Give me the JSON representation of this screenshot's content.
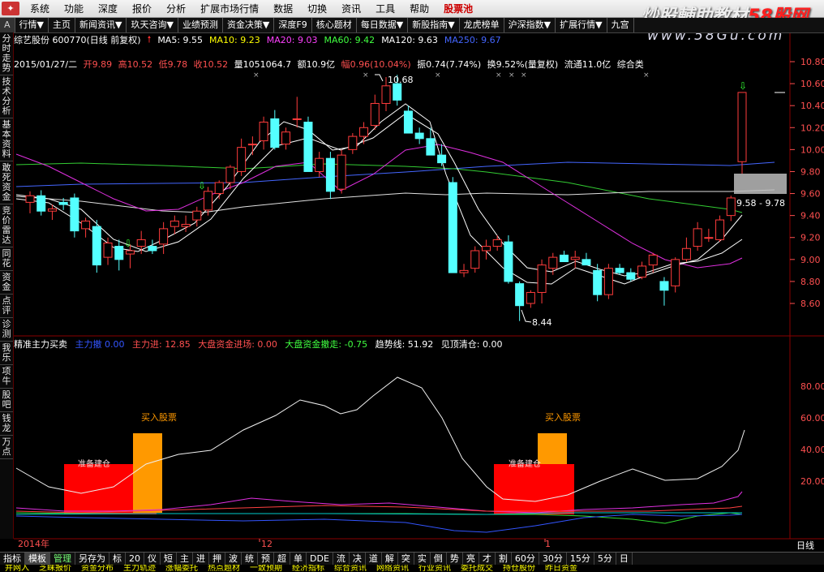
{
  "menubar": {
    "items": [
      "系统",
      "功能",
      "深度",
      "报价",
      "分析",
      "扩展市场行情",
      "数据",
      "切换",
      "资讯",
      "工具",
      "帮助",
      "股票池",
      "闪电"
    ],
    "pool_label": "股票池"
  },
  "watermark": {
    "part1": "炒股輔助教材",
    "part2": "58股网",
    "url": "www.58Gu.com"
  },
  "toolbar": {
    "items": [
      "A",
      "行情▼",
      "主页",
      "新闻资讯▼",
      "玖天咨询▼",
      "业绩预测",
      "资金决策▼",
      "深度F9",
      "核心题材",
      "每日数据▼",
      "新股指南▼",
      "龙虎榜单",
      "沪深指数▼",
      "扩展行情▼",
      "九宫"
    ]
  },
  "sidebar": {
    "items": [
      "分时走势",
      "技术分析",
      "基本资料",
      "敢死资金",
      "竞价雷达",
      "同花",
      "资金",
      "点评",
      "诊测",
      "我乐",
      "项牛",
      "股吧",
      "钱龙",
      "万点"
    ]
  },
  "header": {
    "stock": "综艺股份 600770(日线 前复权)",
    "ma5": "MA5: 9.55",
    "ma10": "MA10: 9.23",
    "ma20": "MA20: 9.03",
    "ma60": "MA60: 9.42",
    "ma120": "MA120: 9.63",
    "ma250": "MA250: 9.67"
  },
  "info": {
    "date": "2015/01/27/二",
    "open": "开9.89",
    "high": "高10.52",
    "low": "低9.78",
    "close": "收10.52",
    "volume": "量1051064.7",
    "amount": "额10.9亿",
    "change": "幅0.96(10.04%)",
    "amplitude": "振0.74(7.74%)",
    "turnover": "换9.52%(量复权)",
    "float": "流通11.0亿",
    "category": "综合类"
  },
  "annotations": {
    "high": "10.68",
    "low": "8.44",
    "range": "9.58 - 9.78"
  },
  "indicator": {
    "name": "精准主力买卖",
    "blue": "主力撤 0.00",
    "red": "主力进: 12.85",
    "big_in": "大盘资金进场: 0.00",
    "big_out": "大盘资金撤走: -0.75",
    "trend": "趋势线: 51.92",
    "top": "见顶清仓: 0.00",
    "buy_label": "买入股票",
    "prepare_label": "准备建仓"
  },
  "price_axis": [
    "10.80",
    "10.60",
    "10.40",
    "10.20",
    "10.00",
    "9.80",
    "9.60",
    "9.40",
    "9.20",
    "9.00",
    "8.80",
    "8.60"
  ],
  "ind_axis": [
    "80.00",
    "60.00",
    "40.00",
    "20.00"
  ],
  "time_axis": [
    "2014年",
    "12",
    "1",
    "日线"
  ],
  "bottombar": {
    "items": [
      "指标",
      "模板",
      "管理",
      "另存为",
      "标",
      "20",
      "仪",
      "短",
      "主",
      "进",
      "押",
      "波",
      "统",
      "预",
      "超",
      "单",
      "DDE",
      "流",
      "决",
      "道",
      "解",
      "突",
      "实",
      "倒",
      "势",
      "亮",
      "才",
      "割",
      "60分",
      "30分",
      "15分",
      "5分",
      "日"
    ]
  },
  "statusbar": {
    "items": [
      "并网入",
      "芝睐报价",
      "资金分布",
      "主力轨迹",
      "涨幅委托",
      "热点题材",
      "一致预期",
      "经济指标",
      "综合资讯",
      "网络资讯",
      "行业资讯",
      "委托成交",
      "持仓股份",
      "昨日资金"
    ]
  },
  "colors": {
    "up": "#ff3c3c",
    "down": "#54ffff",
    "ma5": "#ffffff",
    "ma10": "#ffff00",
    "ma20": "#ff00ff",
    "ma60": "#00ff00",
    "ma250": "#4466ff"
  },
  "chart_data": {
    "type": "candlestick",
    "ylim": [
      8.4,
      10.9
    ],
    "candles": [
      [
        9.52,
        9.62,
        9.42,
        9.58
      ],
      [
        9.58,
        9.63,
        9.4,
        9.44
      ],
      [
        9.44,
        9.5,
        9.36,
        9.46
      ],
      [
        9.52,
        9.56,
        9.45,
        9.5
      ],
      [
        9.56,
        9.6,
        9.2,
        9.26
      ],
      [
        9.28,
        9.38,
        9.2,
        9.35
      ],
      [
        9.3,
        9.36,
        8.88,
        8.95
      ],
      [
        9.02,
        9.2,
        8.95,
        9.15
      ],
      [
        9.12,
        9.18,
        8.9,
        9.0
      ],
      [
        9.05,
        9.14,
        8.92,
        9.08
      ],
      [
        9.12,
        9.26,
        9.05,
        9.18
      ],
      [
        9.12,
        9.18,
        9.05,
        9.08
      ],
      [
        9.14,
        9.34,
        9.05,
        9.28
      ],
      [
        9.3,
        9.4,
        9.23,
        9.35
      ],
      [
        9.3,
        9.4,
        9.25,
        9.32
      ],
      [
        9.36,
        9.48,
        9.3,
        9.44
      ],
      [
        9.45,
        9.66,
        9.4,
        9.62
      ],
      [
        9.6,
        9.72,
        9.55,
        9.7
      ],
      [
        9.7,
        9.86,
        9.64,
        9.84
      ],
      [
        9.8,
        10.1,
        9.76,
        10.02
      ],
      [
        10.05,
        10.12,
        9.95,
        10.05
      ],
      [
        10.08,
        10.3,
        10.0,
        10.25
      ],
      [
        10.28,
        10.36,
        10.0,
        10.02
      ],
      [
        10.05,
        10.2,
        10.0,
        10.16
      ],
      [
        10.28,
        10.48,
        10.2,
        10.28
      ],
      [
        10.25,
        10.3,
        10.02,
        9.8
      ],
      [
        9.8,
        9.98,
        9.75,
        9.92
      ],
      [
        9.92,
        9.98,
        9.55,
        9.62
      ],
      [
        9.64,
        10.0,
        9.6,
        9.95
      ],
      [
        10.0,
        10.15,
        9.96,
        10.12
      ],
      [
        10.12,
        10.25,
        10.05,
        10.2
      ],
      [
        10.22,
        10.5,
        10.18,
        10.42
      ],
      [
        10.42,
        10.66,
        10.35,
        10.58
      ],
      [
        10.6,
        10.68,
        10.4,
        10.45
      ],
      [
        10.35,
        10.4,
        10.15,
        10.15
      ],
      [
        10.15,
        10.2,
        10.05,
        10.1
      ],
      [
        10.1,
        10.2,
        9.95,
        9.95
      ],
      [
        9.95,
        10.05,
        9.85,
        9.88
      ],
      [
        9.7,
        9.75,
        8.88,
        8.88
      ],
      [
        8.88,
        8.96,
        8.84,
        8.9
      ],
      [
        8.92,
        9.12,
        8.88,
        9.08
      ],
      [
        9.08,
        9.18,
        9.0,
        9.12
      ],
      [
        9.12,
        9.22,
        9.08,
        9.18
      ],
      [
        9.16,
        9.22,
        8.78,
        8.8
      ],
      [
        8.78,
        8.8,
        8.44,
        8.58
      ],
      [
        8.6,
        8.72,
        8.56,
        8.7
      ],
      [
        8.7,
        9.0,
        8.6,
        8.95
      ],
      [
        8.92,
        9.06,
        8.86,
        9.02
      ],
      [
        9.04,
        9.08,
        8.98,
        8.98
      ],
      [
        9.0,
        9.08,
        8.92,
        9.02
      ],
      [
        9.0,
        9.06,
        8.95,
        8.95
      ],
      [
        8.9,
        8.96,
        8.62,
        8.68
      ],
      [
        8.68,
        8.96,
        8.64,
        8.92
      ],
      [
        8.92,
        8.96,
        8.86,
        8.88
      ],
      [
        8.88,
        8.92,
        8.8,
        8.82
      ],
      [
        8.84,
        8.98,
        8.82,
        8.94
      ],
      [
        8.95,
        9.06,
        8.88,
        9.04
      ],
      [
        8.8,
        8.84,
        8.58,
        8.72
      ],
      [
        8.76,
        9.02,
        8.7,
        9.0
      ],
      [
        9.0,
        9.2,
        8.98,
        9.1
      ],
      [
        9.12,
        9.34,
        9.08,
        9.28
      ],
      [
        9.2,
        9.28,
        9.16,
        9.2
      ],
      [
        9.18,
        9.4,
        9.16,
        9.36
      ],
      [
        9.4,
        9.58,
        9.35,
        9.56
      ],
      [
        9.89,
        10.52,
        9.78,
        10.52
      ]
    ]
  }
}
